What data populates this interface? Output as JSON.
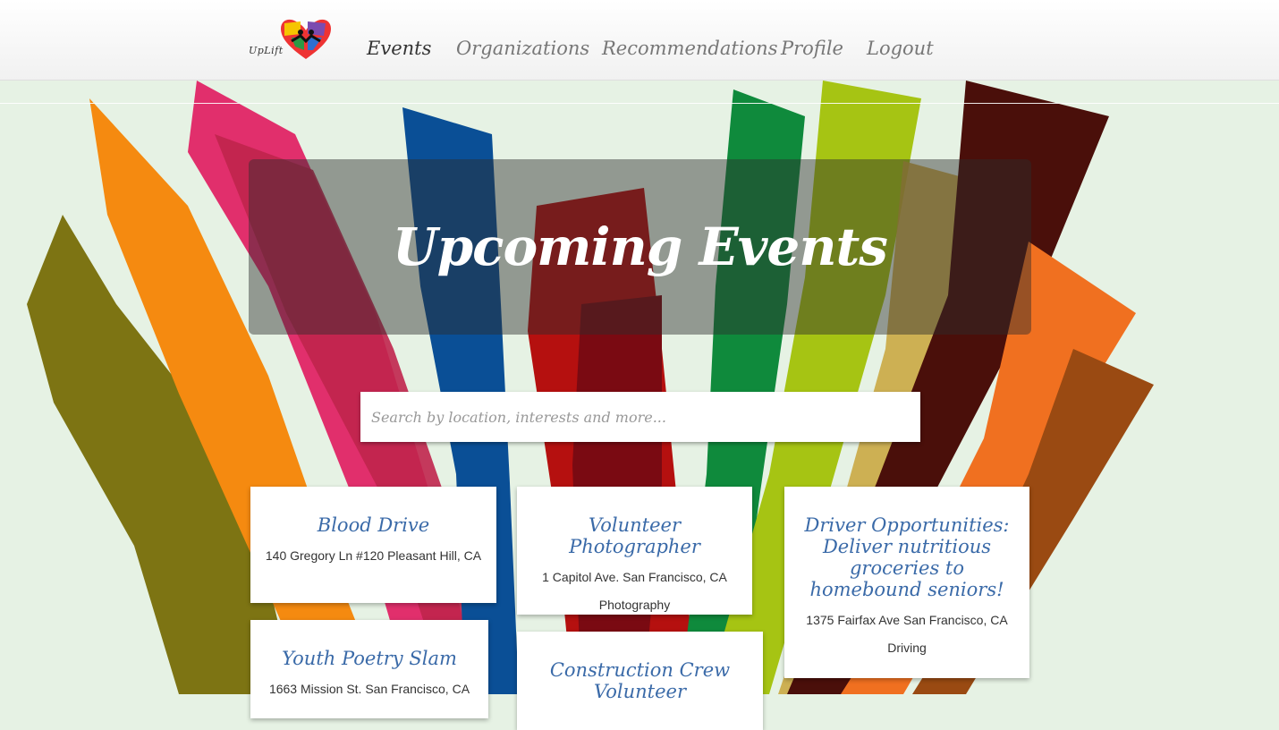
{
  "brand": {
    "logo_text": "UpLift"
  },
  "nav": {
    "items": [
      {
        "label": "Events",
        "active": true
      },
      {
        "label": "Organizations",
        "active": false
      },
      {
        "label": "Recommendations",
        "active": false
      },
      {
        "label": "Profile",
        "active": false
      },
      {
        "label": "Logout",
        "active": false
      }
    ]
  },
  "hero": {
    "title": "Upcoming Events"
  },
  "search": {
    "placeholder": "Search by location, interests and more..."
  },
  "events": [
    {
      "title": "Blood Drive",
      "address": "140 Gregory Ln #120 Pleasant Hill, CA",
      "tag": ""
    },
    {
      "title": "Volunteer Photographer",
      "address": "1 Capitol Ave. San Francisco, CA",
      "tag": "Photography"
    },
    {
      "title": "Driver Opportunities: Deliver nutritious groceries to homebound seniors!",
      "address": "1375 Fairfax Ave San Francisco, CA",
      "tag": "Driving"
    },
    {
      "title": "Youth Poetry Slam",
      "address": "1663 Mission St. San Francisco, CA",
      "tag": ""
    },
    {
      "title": "Construction Crew Volunteer",
      "address": "",
      "tag": ""
    }
  ],
  "colors": {
    "link_blue": "#3a6aa8",
    "background": "#e6f2e4",
    "hands": [
      "#7d7413",
      "#f58a10",
      "#e12f6c",
      "#c0254c",
      "#0a4f96",
      "#b5100f",
      "#0f8a3c",
      "#a6c413",
      "#c8a43a",
      "#4a0f0a",
      "#f07020",
      "#f27d10"
    ]
  }
}
